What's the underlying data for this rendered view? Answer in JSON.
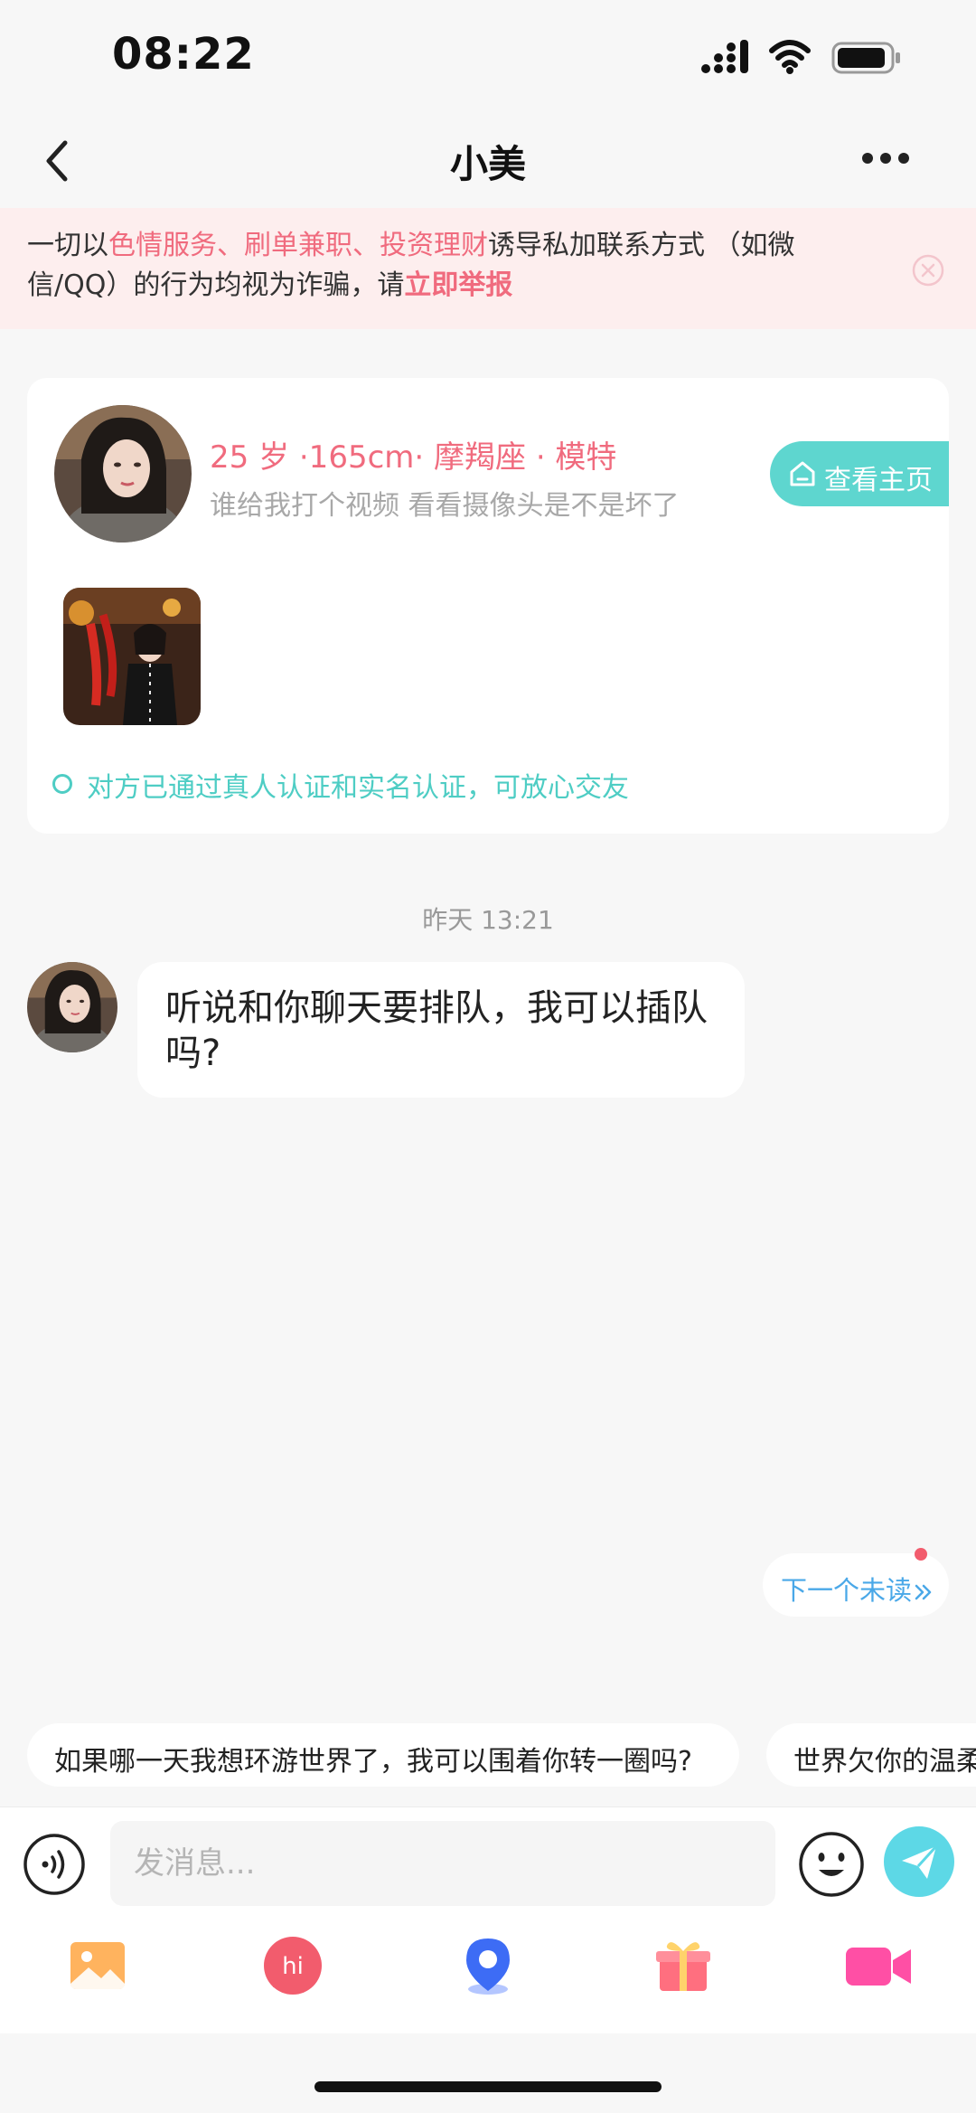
{
  "status_bar": {
    "time": "08:22",
    "icons": [
      "signal-icon",
      "wifi-icon",
      "battery-icon"
    ]
  },
  "nav": {
    "title": "小美",
    "back_icon": "chevron-left-icon",
    "more_icon": "more-dots-icon"
  },
  "warning": {
    "part1": "一切以",
    "highlight": "色情服务、刷单兼职、投资理财",
    "part2": "诱导私加联系方式 （如微信/QQ）的行为均视为诈骗，请",
    "report_link": "立即举报"
  },
  "profile": {
    "info": "25 岁 ·165cm· 摩羯座 · 模特",
    "bio": "谁给我打个视频  看看摄像头是不是坏了",
    "view_button": "查看主页",
    "verified_text": "对方已通过真人认证和实名认证，可放心交友"
  },
  "chat": {
    "timestamp": "昨天 13:21",
    "messages": [
      {
        "sender": "other",
        "text": "听说和你聊天要排队，我可以插队吗?"
      }
    ]
  },
  "next_unread": {
    "label": "下一个未读",
    "icon": "double-chevron-right-icon"
  },
  "suggestions": [
    "如果哪一天我想环游世界了，我可以围着你转一圈吗?",
    "世界欠你的温柔"
  ],
  "input": {
    "placeholder": "发消息...",
    "value": ""
  },
  "toolbar": {
    "items": [
      "image-icon",
      "hi-icon",
      "location-icon",
      "gift-icon",
      "video-call-icon"
    ]
  },
  "colors": {
    "accent_pink": "#f06b7e",
    "accent_teal": "#5ed6cf",
    "send_blue": "#5dd8e6",
    "link_blue": "#4aa8e8"
  }
}
